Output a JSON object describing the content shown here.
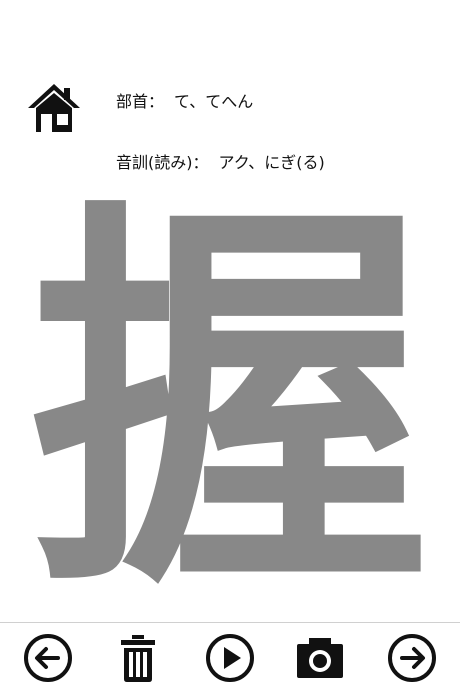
{
  "header": {
    "radical_label": "部首：",
    "radical_value": "て、てへん",
    "reading_label": "音訓(読み)：",
    "reading_value": "アク、にぎ(る)"
  },
  "kanji": {
    "character": "握",
    "color": "#888888"
  },
  "icons": {
    "home": "home-icon",
    "prev": "arrow-left-circle-icon",
    "delete": "trash-icon",
    "play": "play-circle-icon",
    "camera": "camera-icon",
    "next": "arrow-right-circle-icon"
  }
}
